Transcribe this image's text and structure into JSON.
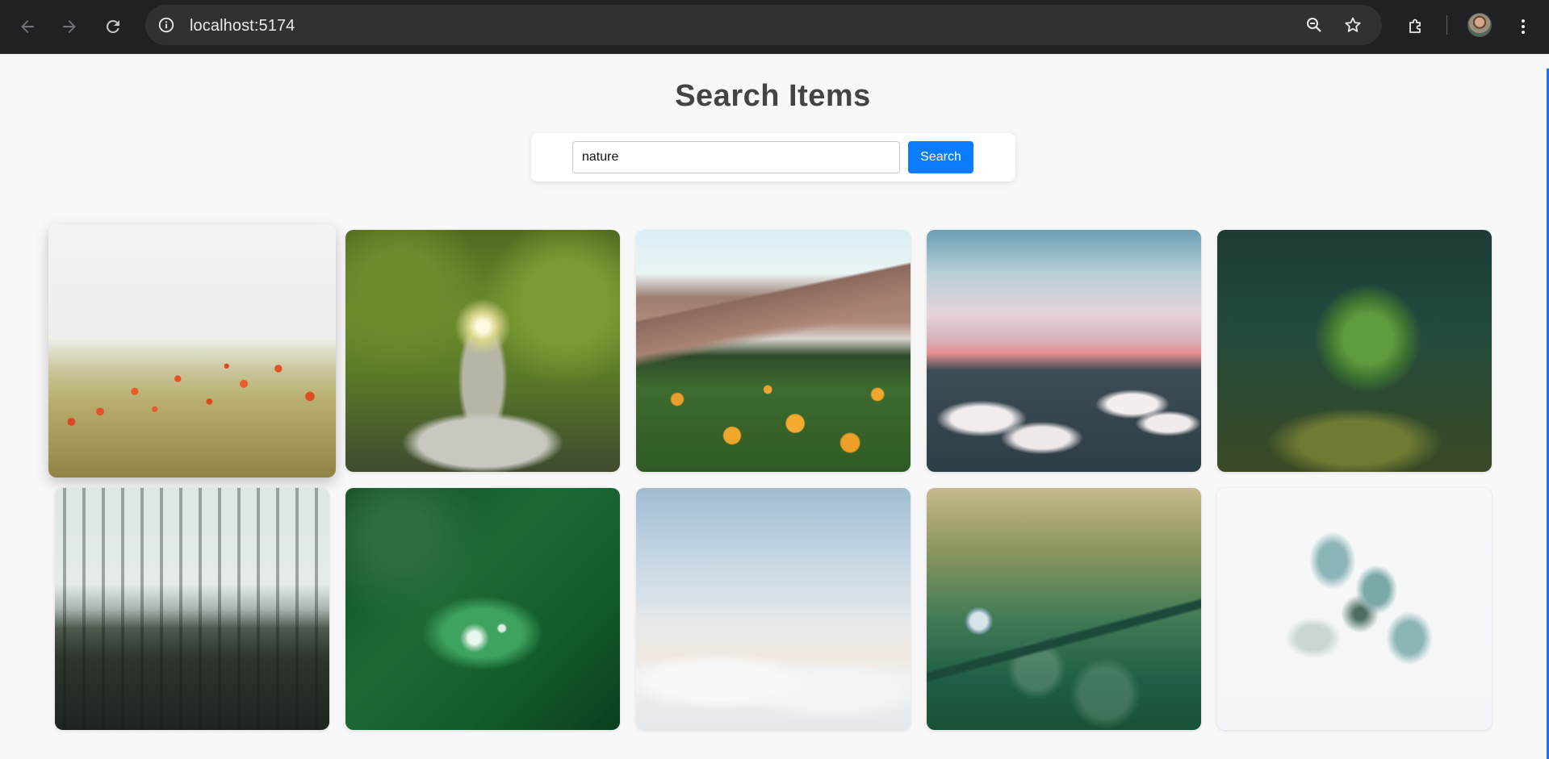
{
  "browser": {
    "url": "localhost:5174",
    "icons": {
      "back": "arrow-left-icon",
      "forward": "arrow-right-icon",
      "reload": "reload-icon",
      "site_info": "info-icon",
      "zoom": "zoom-out-icon",
      "bookmark": "star-icon",
      "extensions": "puzzle-icon",
      "profile": "avatar",
      "menu": "kebab-menu-icon"
    }
  },
  "page": {
    "title": "Search Items",
    "search": {
      "value": "nature",
      "button_label": "Search"
    }
  },
  "gallery": {
    "rows": 2,
    "columns": 5,
    "items": [
      {
        "subject": "poppies",
        "hovered": true
      },
      {
        "subject": "tree"
      },
      {
        "subject": "mountain"
      },
      {
        "subject": "clouds"
      },
      {
        "subject": "moss"
      },
      {
        "subject": "forest"
      },
      {
        "subject": "leaf"
      },
      {
        "subject": "sky"
      },
      {
        "subject": "drop"
      },
      {
        "subject": "flowers"
      }
    ]
  },
  "colors": {
    "accent": "#0a7cff",
    "page_bg": "#f8f8f8",
    "title": "#444444",
    "chrome_bg": "#202124"
  }
}
